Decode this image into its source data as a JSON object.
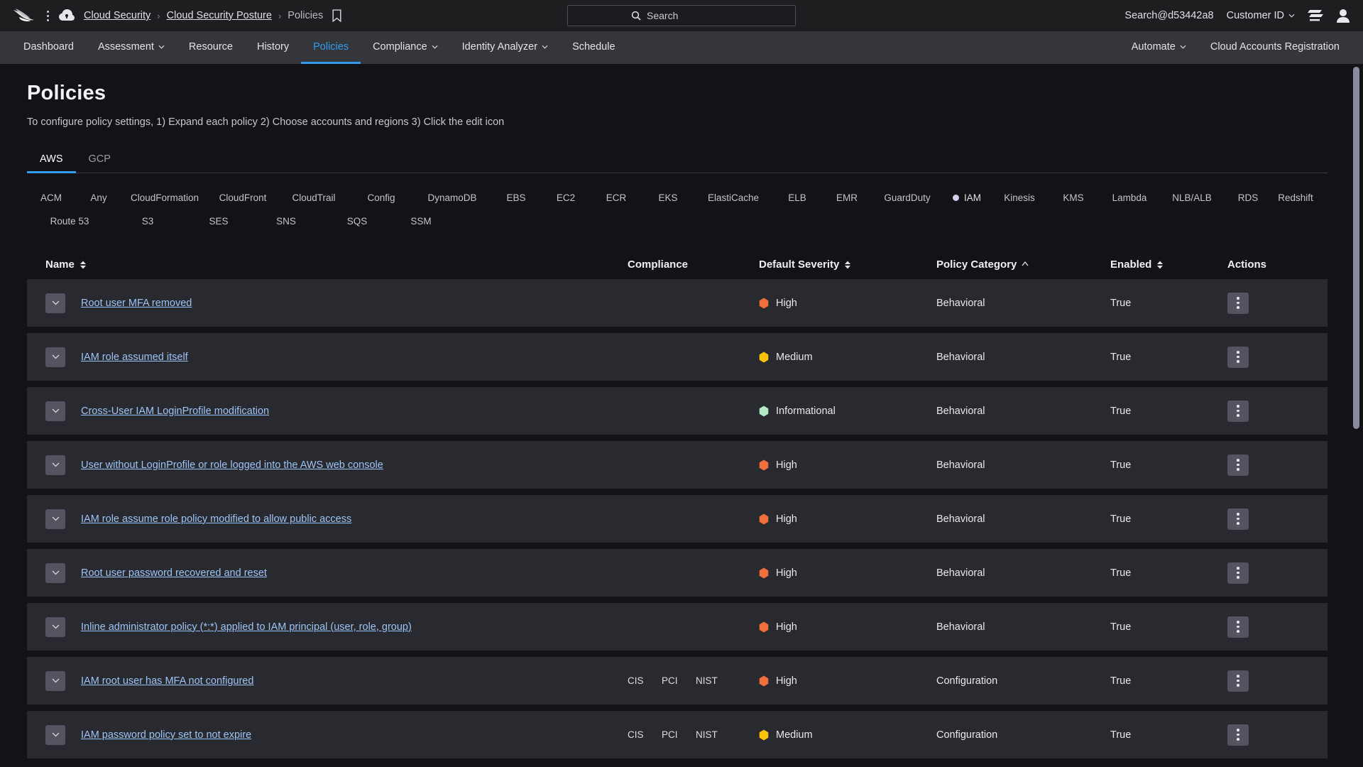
{
  "topbar": {
    "logo_icon": "falcon-logo-icon",
    "menu_icon": "kebab-menu-icon",
    "cloud_icon": "cloud-shield-icon",
    "bookmark_icon": "bookmark-icon",
    "breadcrumb": [
      {
        "label": "Cloud Security",
        "link": true
      },
      {
        "label": "Cloud Security Posture",
        "link": true
      },
      {
        "label": "Policies",
        "link": false
      }
    ],
    "separator": "›",
    "search": {
      "placeholder": "Search",
      "value": "",
      "icon": "search-icon"
    },
    "account": "Search@d53442a8",
    "customer_id_label": "Customer ID",
    "support_icon": "support-chat-icon",
    "avatar_icon": "user-avatar-icon"
  },
  "nav": {
    "left_items": [
      {
        "label": "Dashboard",
        "caret": false,
        "active": false
      },
      {
        "label": "Assessment",
        "caret": true,
        "active": false
      },
      {
        "label": "Resource",
        "caret": false,
        "active": false
      },
      {
        "label": "History",
        "caret": false,
        "active": false
      },
      {
        "label": "Policies",
        "caret": false,
        "active": true
      },
      {
        "label": "Compliance",
        "caret": true,
        "active": false
      },
      {
        "label": "Identity Analyzer",
        "caret": true,
        "active": false
      },
      {
        "label": "Schedule",
        "caret": false,
        "active": false
      }
    ],
    "right_items": [
      {
        "label": "Automate",
        "caret": true,
        "active": false
      },
      {
        "label": "Cloud Accounts Registration",
        "caret": false,
        "active": false
      }
    ]
  },
  "page": {
    "title": "Policies",
    "subtitle": "To configure policy settings, 1) Expand each policy 2) Choose accounts and regions 3) Click the edit icon",
    "tabs": [
      {
        "label": "AWS",
        "active": true
      },
      {
        "label": "GCP",
        "active": false
      }
    ],
    "service_chips": [
      {
        "label": "ACM",
        "selected": false
      },
      {
        "label": "Any",
        "selected": false
      },
      {
        "label": "CloudFormation",
        "selected": false
      },
      {
        "label": "CloudFront",
        "selected": false
      },
      {
        "label": "CloudTrail",
        "selected": false
      },
      {
        "label": "Config",
        "selected": false
      },
      {
        "label": "DynamoDB",
        "selected": false
      },
      {
        "label": "EBS",
        "selected": false
      },
      {
        "label": "EC2",
        "selected": false
      },
      {
        "label": "ECR",
        "selected": false
      },
      {
        "label": "EKS",
        "selected": false
      },
      {
        "label": "ElastiCache",
        "selected": false
      },
      {
        "label": "ELB",
        "selected": false
      },
      {
        "label": "EMR",
        "selected": false
      },
      {
        "label": "GuardDuty",
        "selected": false
      },
      {
        "label": "IAM",
        "selected": true
      },
      {
        "label": "Kinesis",
        "selected": false
      },
      {
        "label": "KMS",
        "selected": false
      },
      {
        "label": "Lambda",
        "selected": false
      },
      {
        "label": "NLB/ALB",
        "selected": false
      },
      {
        "label": "RDS",
        "selected": false
      },
      {
        "label": "Redshift",
        "selected": false
      },
      {
        "label": "Route 53",
        "selected": false
      },
      {
        "label": "S3",
        "selected": false
      },
      {
        "label": "SES",
        "selected": false
      },
      {
        "label": "SNS",
        "selected": false
      },
      {
        "label": "SQS",
        "selected": false
      },
      {
        "label": "SSM",
        "selected": false
      }
    ]
  },
  "table": {
    "columns": [
      {
        "label": "Name",
        "sort": "both"
      },
      {
        "label": "Compliance",
        "sort": "none"
      },
      {
        "label": "Default Severity",
        "sort": "both"
      },
      {
        "label": "Policy Category",
        "sort": "asc"
      },
      {
        "label": "Enabled",
        "sort": "both"
      },
      {
        "label": "Actions",
        "sort": "none"
      }
    ],
    "rows": [
      {
        "name": "Root user MFA removed",
        "compliance": [],
        "severity": "High",
        "severity_color": "#f0703c",
        "category": "Behavioral",
        "enabled": "True"
      },
      {
        "name": "IAM role assumed itself",
        "compliance": [],
        "severity": "Medium",
        "severity_color": "#fbc108",
        "category": "Behavioral",
        "enabled": "True"
      },
      {
        "name": "Cross-User IAM LoginProfile modification",
        "compliance": [],
        "severity": "Informational",
        "severity_color": "#b5e8c4",
        "category": "Behavioral",
        "enabled": "True"
      },
      {
        "name": "User without LoginProfile or role logged into the AWS web console",
        "compliance": [],
        "severity": "High",
        "severity_color": "#f0703c",
        "category": "Behavioral",
        "enabled": "True"
      },
      {
        "name": "IAM role assume role policy modified to allow public access",
        "compliance": [],
        "severity": "High",
        "severity_color": "#f0703c",
        "category": "Behavioral",
        "enabled": "True"
      },
      {
        "name": "Root user password recovered and reset",
        "compliance": [],
        "severity": "High",
        "severity_color": "#f0703c",
        "category": "Behavioral",
        "enabled": "True"
      },
      {
        "name": "Inline administrator policy (*:*) applied to IAM principal (user, role, group)",
        "compliance": [],
        "severity": "High",
        "severity_color": "#f0703c",
        "category": "Behavioral",
        "enabled": "True"
      },
      {
        "name": "IAM root user has MFA not configured",
        "compliance": [
          "CIS",
          "PCI",
          "NIST"
        ],
        "severity": "High",
        "severity_color": "#f0703c",
        "category": "Configuration",
        "enabled": "True"
      },
      {
        "name": "IAM password policy set to not expire",
        "compliance": [
          "CIS",
          "PCI",
          "NIST"
        ],
        "severity": "Medium",
        "severity_color": "#fbc108",
        "category": "Configuration",
        "enabled": "True"
      }
    ],
    "expand_icon": "chevron-down-icon",
    "actions_icon": "kebab-menu-icon"
  },
  "colors": {
    "accent": "#2f9ced",
    "link": "#9cc4f5",
    "row_bg": "#292930",
    "page_bg": "#131317",
    "nav_bg": "#35363b",
    "topbar_bg": "#1e1e21"
  }
}
